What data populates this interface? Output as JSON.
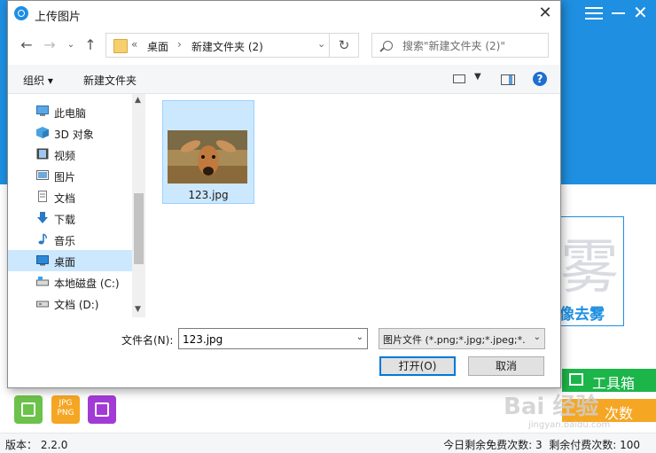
{
  "app": {
    "dehaze_label": "像去雾",
    "dehaze_glyph": "雾",
    "toolbox_label": "工具箱",
    "buy_label": "次数",
    "jpg_icon_text": "JPG PNG",
    "version_label": "版本：",
    "version": "2.2.0",
    "free_label": "今日剩余免费次数:",
    "free_count": "3",
    "paid_label": "剩余付费次数:",
    "paid_count": "100",
    "watermark": "Bai 经验",
    "watermark_url": "jingyan.baidu.com",
    "brand_color": "#1e8fe1"
  },
  "dialog": {
    "title": "上传图片",
    "address": {
      "chevrons": "«",
      "segments": [
        "桌面",
        "新建文件夹 (2)"
      ]
    },
    "search_placeholder": "搜索\"新建文件夹 (2)\"",
    "commands": {
      "organize": "组织 ▾",
      "new_folder": "新建文件夹"
    },
    "nav_items": [
      {
        "label": "此电脑",
        "icon": "computer-icon"
      },
      {
        "label": "3D 对象",
        "icon": "3d-objects-icon"
      },
      {
        "label": "视频",
        "icon": "video-icon"
      },
      {
        "label": "图片",
        "icon": "pictures-icon"
      },
      {
        "label": "文档",
        "icon": "documents-icon"
      },
      {
        "label": "下载",
        "icon": "download-icon"
      },
      {
        "label": "音乐",
        "icon": "music-icon"
      },
      {
        "label": "桌面",
        "icon": "desktop-icon",
        "selected": true
      },
      {
        "label": "本地磁盘 (C:)",
        "icon": "drive-icon"
      },
      {
        "label": "文档 (D:)",
        "icon": "drive-icon"
      }
    ],
    "files": [
      {
        "name": "123.jpg"
      }
    ],
    "filename_label": "文件名(N):",
    "filename_value": "123.jpg",
    "filetype_value": "图片文件 (*.png;*.jpg;*.jpeg;*.",
    "open_button": "打开(O)",
    "cancel_button": "取消"
  }
}
